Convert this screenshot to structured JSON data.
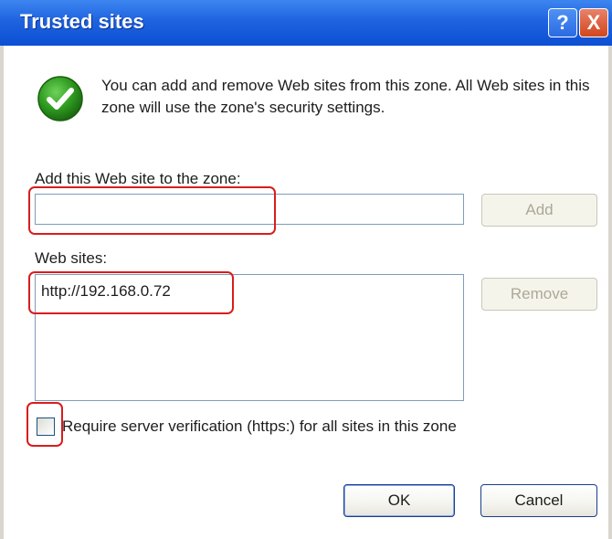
{
  "dialog": {
    "title": "Trusted sites",
    "help_label": "?",
    "close_label": "X"
  },
  "info": {
    "text": "You can add and remove Web sites from this zone. All Web sites in this zone will use the zone's security settings."
  },
  "add_site": {
    "label": "Add this Web site to the zone:",
    "value": "",
    "button_label": "Add"
  },
  "web_sites": {
    "label": "Web sites:",
    "items": [
      "http://192.168.0.72"
    ],
    "remove_label": "Remove"
  },
  "verification": {
    "label": "Require server verification (https:) for all sites in this zone",
    "checked": false
  },
  "footer": {
    "ok_label": "OK",
    "cancel_label": "Cancel"
  },
  "colors": {
    "titlebar": "#1f63e0",
    "highlight": "#d81d1d",
    "check_icon": "#2e8b1e"
  },
  "icons": {
    "info": "green-check-icon",
    "help": "question-mark-icon",
    "close": "close-x-icon"
  }
}
